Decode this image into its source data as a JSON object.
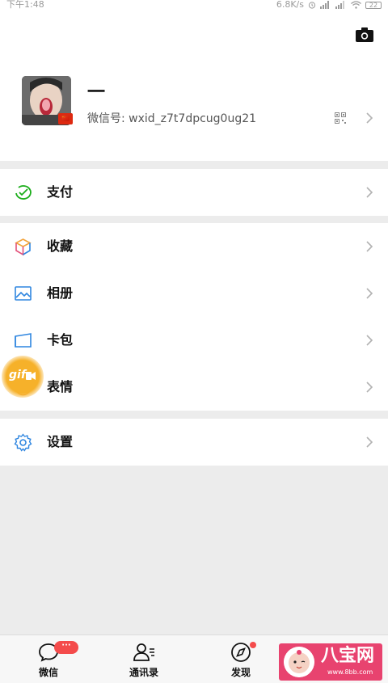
{
  "status_bar": {
    "time": "下午1:48",
    "network_speed": "6.8K/s",
    "battery": "22"
  },
  "profile": {
    "nickname": "一",
    "wechat_id": "微信号: wxid_z7t7dpcug0ug21",
    "flag": "🇨🇳"
  },
  "menu": {
    "pay": "支付",
    "favorites": "收藏",
    "album": "相册",
    "cards": "卡包",
    "stickers": "表情",
    "settings": "设置"
  },
  "floating_widget": {
    "label": "gif"
  },
  "tabbar": {
    "chats": "微信",
    "contacts": "通讯录",
    "discover": "发现",
    "chats_badge": "···"
  },
  "watermark": {
    "text": "八宝网",
    "url": "www.8bb.com"
  },
  "colors": {
    "accent_green": "#1aad19",
    "badge_red": "#f44b4b",
    "icon_blue": "#2f86e0",
    "gif_orange": "#f6b12a"
  }
}
